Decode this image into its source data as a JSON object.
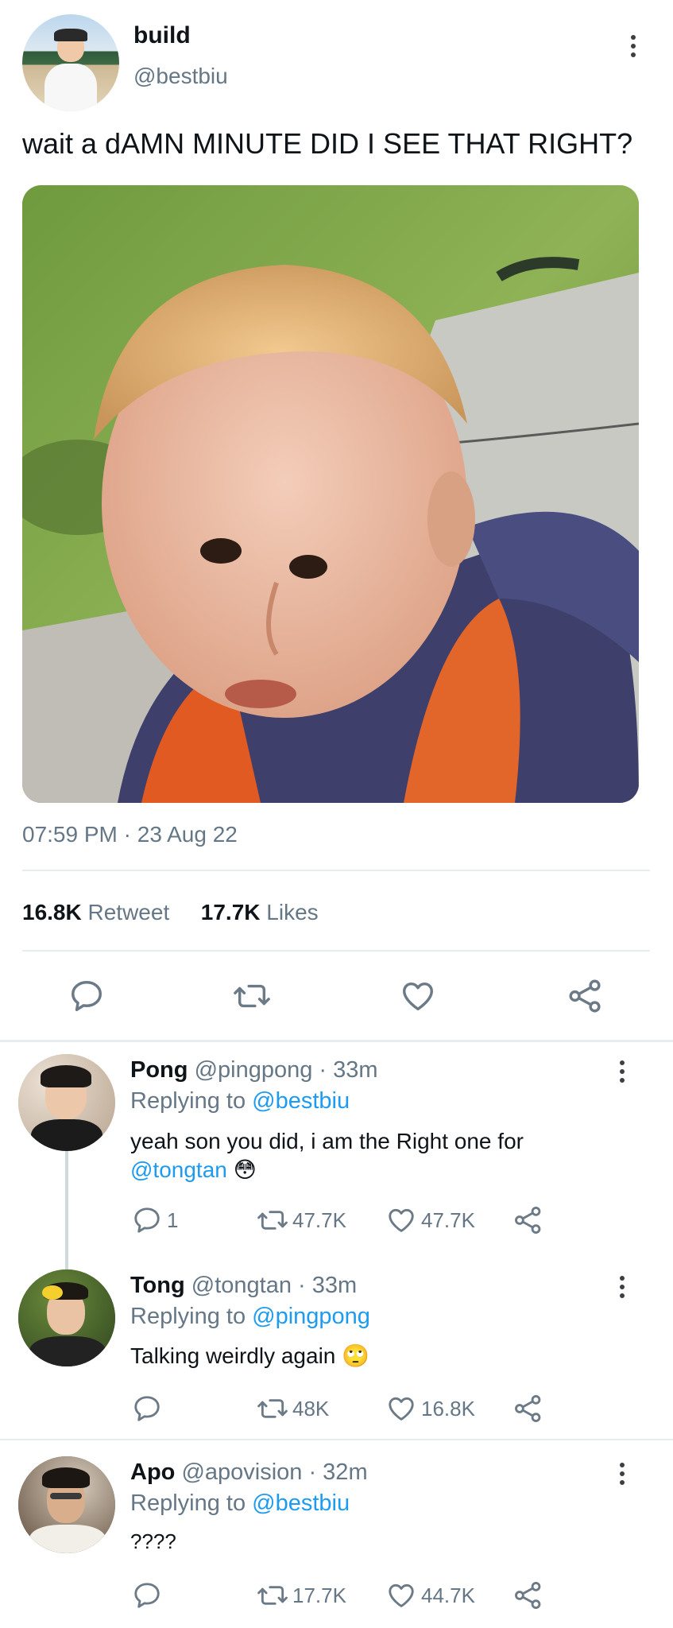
{
  "tweet": {
    "name": "build",
    "handle": "@bestbiu",
    "text": "wait a dAMN MINUTE DID I SEE THAT RIGHT?",
    "time": "07:59 PM",
    "sep": "·",
    "date": "23 Aug 22",
    "retweets_count": "16.8K",
    "retweets_label": "Retweet",
    "likes_count": "17.7K",
    "likes_label": "Likes"
  },
  "replies": [
    {
      "name": "Pong",
      "handle": "@pingpong",
      "time": "· 33m",
      "replying_label": "Replying to",
      "replying_to": "@bestbiu",
      "text_line1": "yeah son you did, i am the Right one for",
      "mention": "@tongtan",
      "emoji": "😳",
      "reply_count": "1",
      "retweet_count": "47.7K",
      "like_count": "47.7K"
    },
    {
      "name": "Tong",
      "handle": "@tongtan",
      "time": "· 33m",
      "replying_label": "Replying to",
      "replying_to": "@pingpong",
      "text": "Talking weirdly again",
      "emoji": "🙄",
      "retweet_count": "48K",
      "like_count": "16.8K"
    },
    {
      "name": "Apo",
      "handle": "@apovision",
      "time": "· 32m",
      "replying_label": "Replying to",
      "replying_to": "@bestbiu",
      "text": "????",
      "retweet_count": "17.7K",
      "like_count": "44.7K"
    }
  ],
  "colors": {
    "accent": "#1d9bf0",
    "muted": "#657786",
    "icon": "#6b7a86",
    "divider": "#e6ecf0"
  }
}
